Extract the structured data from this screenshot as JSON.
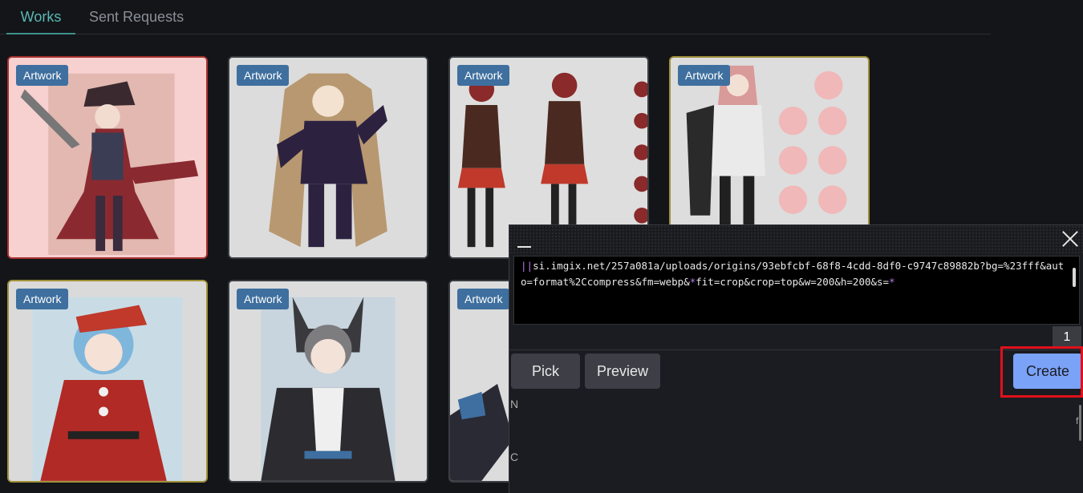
{
  "tabs": [
    {
      "label": "Works",
      "active": true
    },
    {
      "label": "Sent Requests",
      "active": false
    }
  ],
  "cards": [
    {
      "badge": "Artwork",
      "image": "pirate-girl-artwork",
      "highlight": "red"
    },
    {
      "badge": "Artwork",
      "image": "fox-girl-twin-tails-artwork",
      "highlight": "none"
    },
    {
      "badge": "Artwork",
      "image": "red-hair-reference-sheet-artwork",
      "highlight": "none"
    },
    {
      "badge": "Artwork",
      "image": "pink-hair-expressions-artwork",
      "highlight": "gold"
    },
    {
      "badge": "Artwork",
      "image": "santa-outfit-girl-artwork",
      "highlight": "gold"
    },
    {
      "badge": "Artwork",
      "image": "cat-ear-girl-suit-artwork",
      "highlight": "none"
    },
    {
      "badge": "Artwork",
      "image": "partial-artwork",
      "highlight": "none"
    }
  ],
  "popup": {
    "minimize_label": "_",
    "editor_prefix": "||",
    "editor_text_a": "si.imgix.net/257a081a/uploads/origins/93ebfcbf-68f8-4cdd-8df0-c9747c89882b?bg=%23fff&auto=format%2Ccompress&fm=webp&",
    "editor_star_1": "*",
    "editor_text_b": "fit=crop&crop=top&w=200&h=200&s=",
    "editor_star_2": "*",
    "line_count": "1",
    "pick_label": "Pick",
    "preview_label": "Preview",
    "create_label": "Create"
  },
  "stray": {
    "left_char_1": "N",
    "left_char_2": "C",
    "right_char": "f"
  },
  "colors": {
    "accent": "#5cb8b2",
    "create_button": "#7aa2f7",
    "highlight_box": "#e0111b",
    "badge": "#3e6f9e"
  }
}
